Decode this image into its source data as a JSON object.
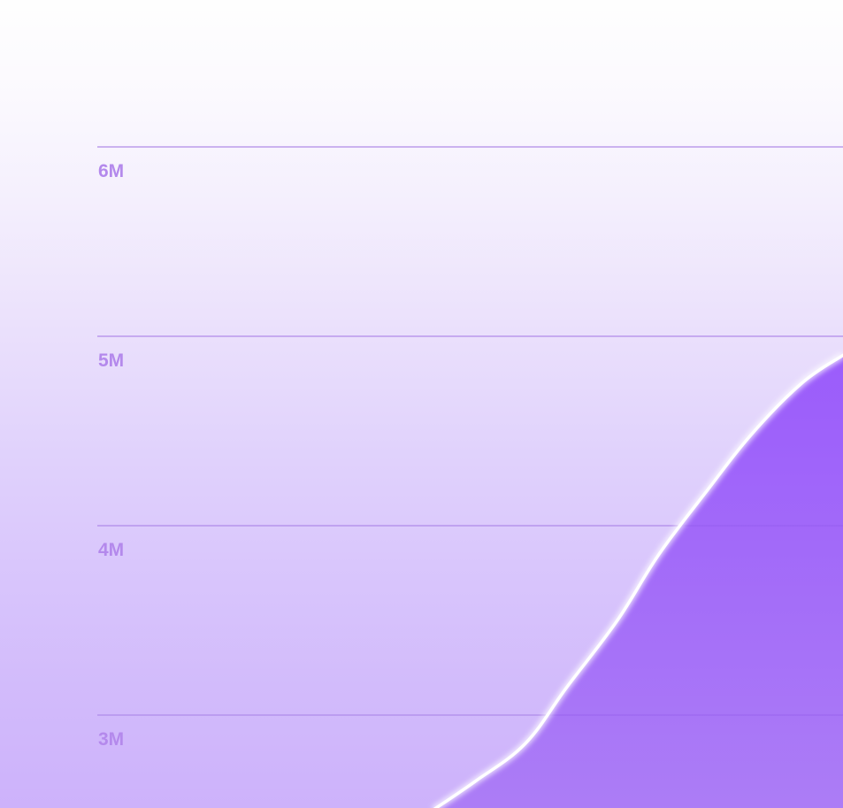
{
  "chart_data": {
    "type": "area",
    "title": "",
    "xlabel": "",
    "ylabel": "",
    "y_ticks": [
      {
        "value": 6000000,
        "label": "6M"
      },
      {
        "value": 5000000,
        "label": "5M"
      },
      {
        "value": 4000000,
        "label": "4M"
      },
      {
        "value": 3000000,
        "label": "3M"
      }
    ],
    "ylim": [
      2500000,
      6750000
    ],
    "xlim": [
      0,
      1
    ],
    "grid": true,
    "legend": "none",
    "series": [
      {
        "x": [
          0.51,
          0.56,
          0.62,
          0.67,
          0.73,
          0.78,
          0.84,
          0.89,
          0.95,
          1.0
        ],
        "values": [
          2500000,
          2650000,
          2850000,
          3150000,
          3500000,
          3850000,
          4200000,
          4480000,
          4750000,
          4900000
        ]
      }
    ]
  },
  "colors": {
    "grid": "#c9b0ea",
    "tick_label": "#b489ec",
    "area_top": "#9b5cfb",
    "area_bottom": "#ac7df6",
    "line": "#ffffff"
  }
}
